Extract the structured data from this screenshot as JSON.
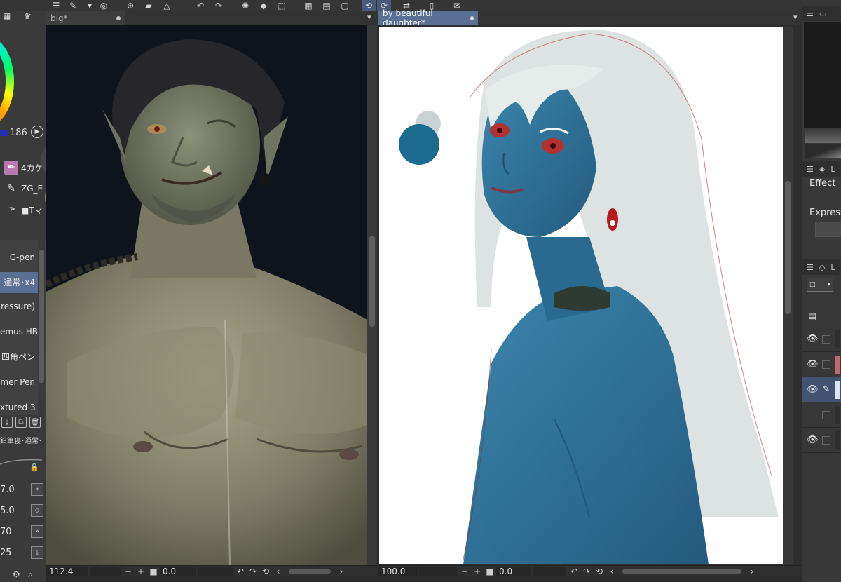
{
  "toolbar": {
    "icons": [
      "menu-icon",
      "pen-tool-icon",
      "layer-icon",
      "transform-icon",
      "folder-icon",
      "fill-icon",
      "undo-icon",
      "redo-icon",
      "loading-icon",
      "eraser-icon",
      "select-icon",
      "grid-icon",
      "ruler-icon",
      "perspective-icon",
      "lasso-icon",
      "flip-icon",
      "phone-icon",
      "message-icon"
    ]
  },
  "left_panel": {
    "hue_value": "186",
    "sub_tools": [
      {
        "icon": "brush-icon",
        "label": "4カケ"
      },
      {
        "icon": "pen-icon",
        "label": "ZG_E"
      },
      {
        "icon": "nib-icon",
        "label": "■Tマ"
      }
    ],
    "brushes": [
      {
        "label": "G-pen",
        "selected": false
      },
      {
        "label": "通常･x4",
        "selected": true
      },
      {
        "label": "ressure)",
        "selected": false
      },
      {
        "label": "emus HB",
        "selected": false
      },
      {
        "label": "四角ペン",
        "selected": false
      },
      {
        "label": "mer Pen",
        "selected": false
      },
      {
        "label": "xtured 3",
        "selected": false
      }
    ],
    "brush_desc": "鉛筆寝･通常･",
    "properties": [
      {
        "value": "7.0",
        "icon": "double-chevron-icon"
      },
      {
        "value": "5.0",
        "icon": "diamond-icon"
      },
      {
        "value": "70",
        "icon": "double-chevron-icon"
      },
      {
        "value": "25",
        "icon": "download-icon"
      }
    ]
  },
  "canvas_left": {
    "tab_label": "big*",
    "zoom": "112.4",
    "angle": "0.0"
  },
  "canvas_right": {
    "tab_label": "by beautiful daughter*",
    "zoom": "100.0",
    "angle": "0.0"
  },
  "right_panel": {
    "effect_label": "Effect",
    "express_label": "Express",
    "layers": [
      {
        "visible": true,
        "thumb": "dark",
        "selected": false
      },
      {
        "visible": true,
        "thumb": "red",
        "selected": false
      },
      {
        "visible": true,
        "thumb": "dark",
        "selected": true
      },
      {
        "visible": false,
        "thumb": "dark",
        "selected": false
      },
      {
        "visible": true,
        "thumb": "dark",
        "selected": false
      }
    ]
  },
  "colors": {
    "accent": "#5a6f94",
    "palette_teal": "#1a6b8e",
    "palette_gray": "#c8d2d2",
    "skin_blue": "#2f6e93",
    "hair_white": "#dce3e2"
  }
}
